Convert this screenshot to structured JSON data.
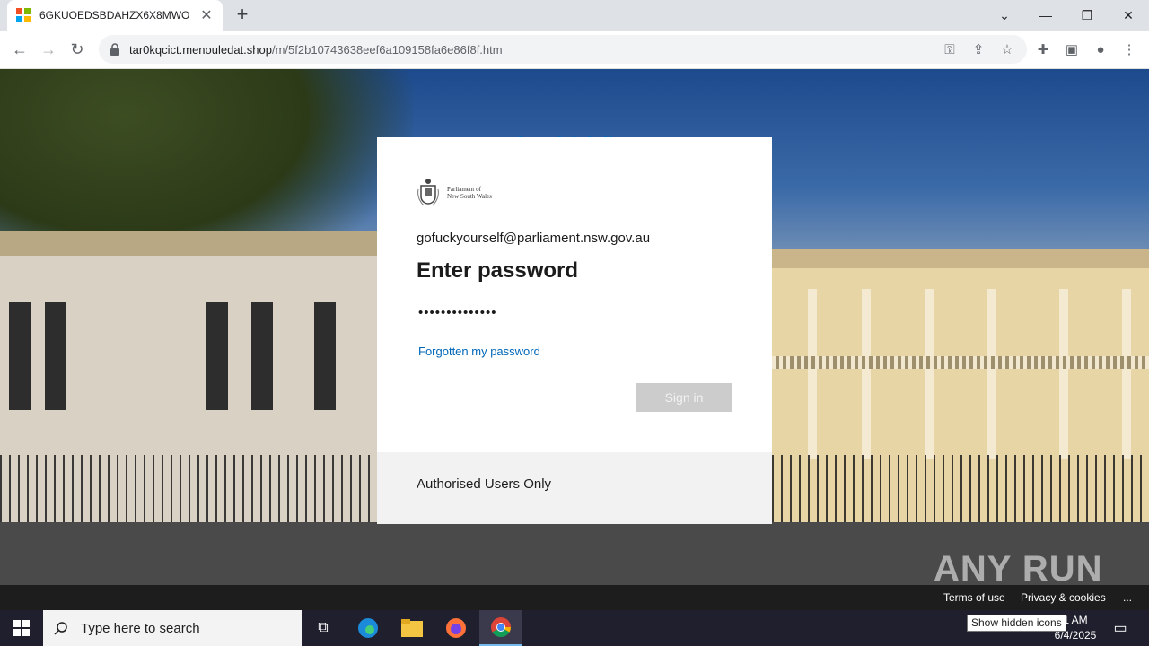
{
  "browser": {
    "tab_title": "6GKUOEDSBDAHZX6X8MWO",
    "url_host": "tar0kqcict.menouledat.shop",
    "url_path": "/m/5f2b10743638eef6a109158fa6e86f8f.htm"
  },
  "login": {
    "logo_line1": "Parliament of",
    "logo_line2": "New South Wales",
    "email": "gofuckyourself@parliament.nsw.gov.au",
    "heading": "Enter password",
    "password_value": "••••••••••••••",
    "forgot_label": "Forgotten my password",
    "signin_label": "Sign in",
    "footer_text": "Authorised Users Only"
  },
  "page_footer": {
    "terms": "Terms of use",
    "privacy": "Privacy & cookies",
    "more": "..."
  },
  "watermark": "ANY RUN",
  "taskbar": {
    "search_placeholder": "Type here to search",
    "time": "1 AM",
    "date": "6/4/2025",
    "tooltip": "Show hidden icons"
  },
  "colors": {
    "accent": "#0067b8",
    "signin_disabled": "#cccccc"
  }
}
